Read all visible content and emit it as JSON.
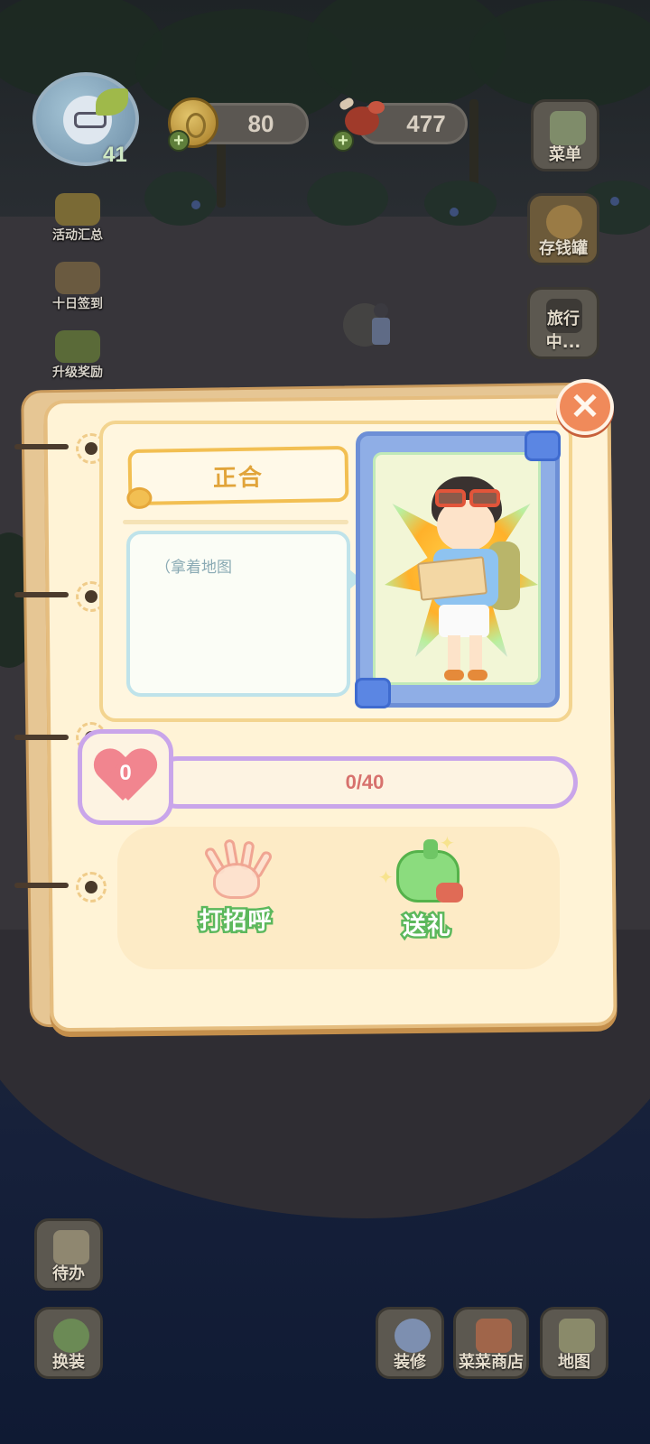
{
  "hud": {
    "level": "41",
    "coins": "80",
    "food": "477",
    "plus": "+"
  },
  "left_menu": {
    "events": "活动汇总",
    "checkin": "十日签到",
    "level_reward": "升级奖励"
  },
  "right_menu": {
    "menu": "菜单",
    "piggy_bank": "存钱罐",
    "traveling": "旅行中..."
  },
  "bottom_left": {
    "todo": "待办",
    "dress": "换装"
  },
  "bottom_right": {
    "decorate": "装修",
    "shop": "菜菜商店",
    "map": "地图"
  },
  "dialog": {
    "name": "正合",
    "speech": "（拿着地图",
    "affection_level": "0",
    "affection_progress": "0/40",
    "affection_fraction": 0.0,
    "greet_label": "打招呼",
    "gift_label": "送礼",
    "close_symbol": "✕"
  },
  "colors": {
    "panel": "#fff3d6",
    "accent_orange": "#f2bf52",
    "progress_border": "#c9a5ea",
    "action_green": "#5cb85c",
    "close": "#f08a5a"
  }
}
